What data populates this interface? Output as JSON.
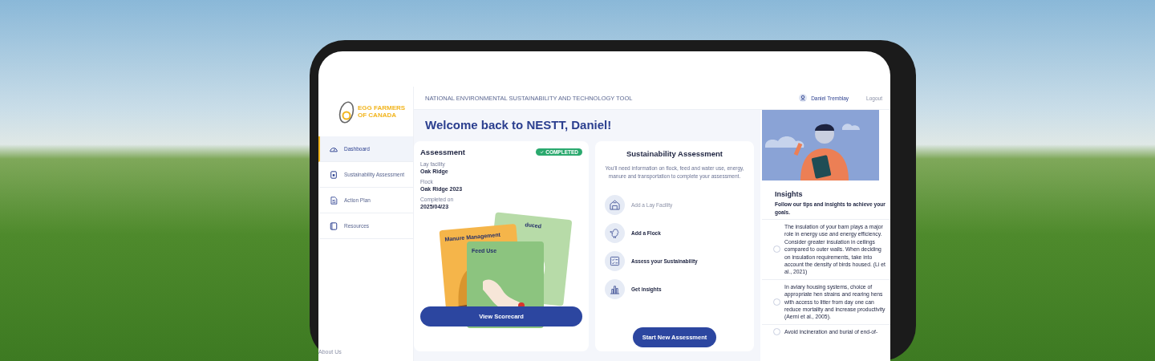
{
  "sidebar": {
    "logo_lines": [
      "EGG FARMERS",
      "OF CANADA"
    ],
    "items": [
      {
        "label": "Dashboard",
        "selected": true
      },
      {
        "label": "Sustainability Assessment",
        "selected": false
      },
      {
        "label": "Action Plan",
        "selected": false
      },
      {
        "label": "Resources",
        "selected": false
      }
    ],
    "footer_link": "About Us"
  },
  "header": {
    "title": "NATIONAL ENVIRONMENTAL SUSTAINABILITY AND TECHNOLOGY TOOL",
    "user": "Daniel Tremblay",
    "logout": "Logout"
  },
  "welcome": "Welcome back to NESTT, Daniel!",
  "assessment_card": {
    "title": "Assessment",
    "badge": "COMPLETED",
    "fields": [
      {
        "label": "Lay facility",
        "value": "Oak Ridge"
      },
      {
        "label": "Flock",
        "value": "Oak Ridge 2023"
      },
      {
        "label": "Completed on",
        "value": "2025/04/23"
      }
    ],
    "illustration_cards": [
      {
        "label": "duced",
        "kind": "back"
      },
      {
        "label": "Manure Management",
        "kind": "middle"
      },
      {
        "label": "Feed Use",
        "kind": "front"
      }
    ],
    "button": "View Scorecard"
  },
  "sustainability_card": {
    "title": "Sustainability Assessment",
    "description": "You'll need information on flock, feed and water use, energy, manure and transportation to complete your assessment.",
    "steps": [
      {
        "label": "Add a Lay Facility",
        "muted": true
      },
      {
        "label": "Add a Flock",
        "muted": false
      },
      {
        "label": "Assess your Sustainability",
        "muted": false
      },
      {
        "label": "Get insights",
        "muted": false
      }
    ],
    "button": "Start New Assessment"
  },
  "insights": {
    "title": "Insights",
    "subtitle": "Follow our tips and insights to achieve your goals.",
    "items": [
      {
        "text": "The insulation of your barn plays a major role in energy use and energy efficiency. Consider greater insulation in ceilings compared to outer walls. When deciding on insulation requirements, take into account the density of birds housed. (Li et al., 2021)",
        "checked": false
      },
      {
        "text": "In aviary housing systems, choice of appropriate hen strains and rearing hens with access to litter from day one can reduce mortality and increase productivity (Aerni et al., 2005).",
        "checked": false
      },
      {
        "text": "Avoid incineration and burial of end-of-",
        "checked": false
      }
    ]
  }
}
